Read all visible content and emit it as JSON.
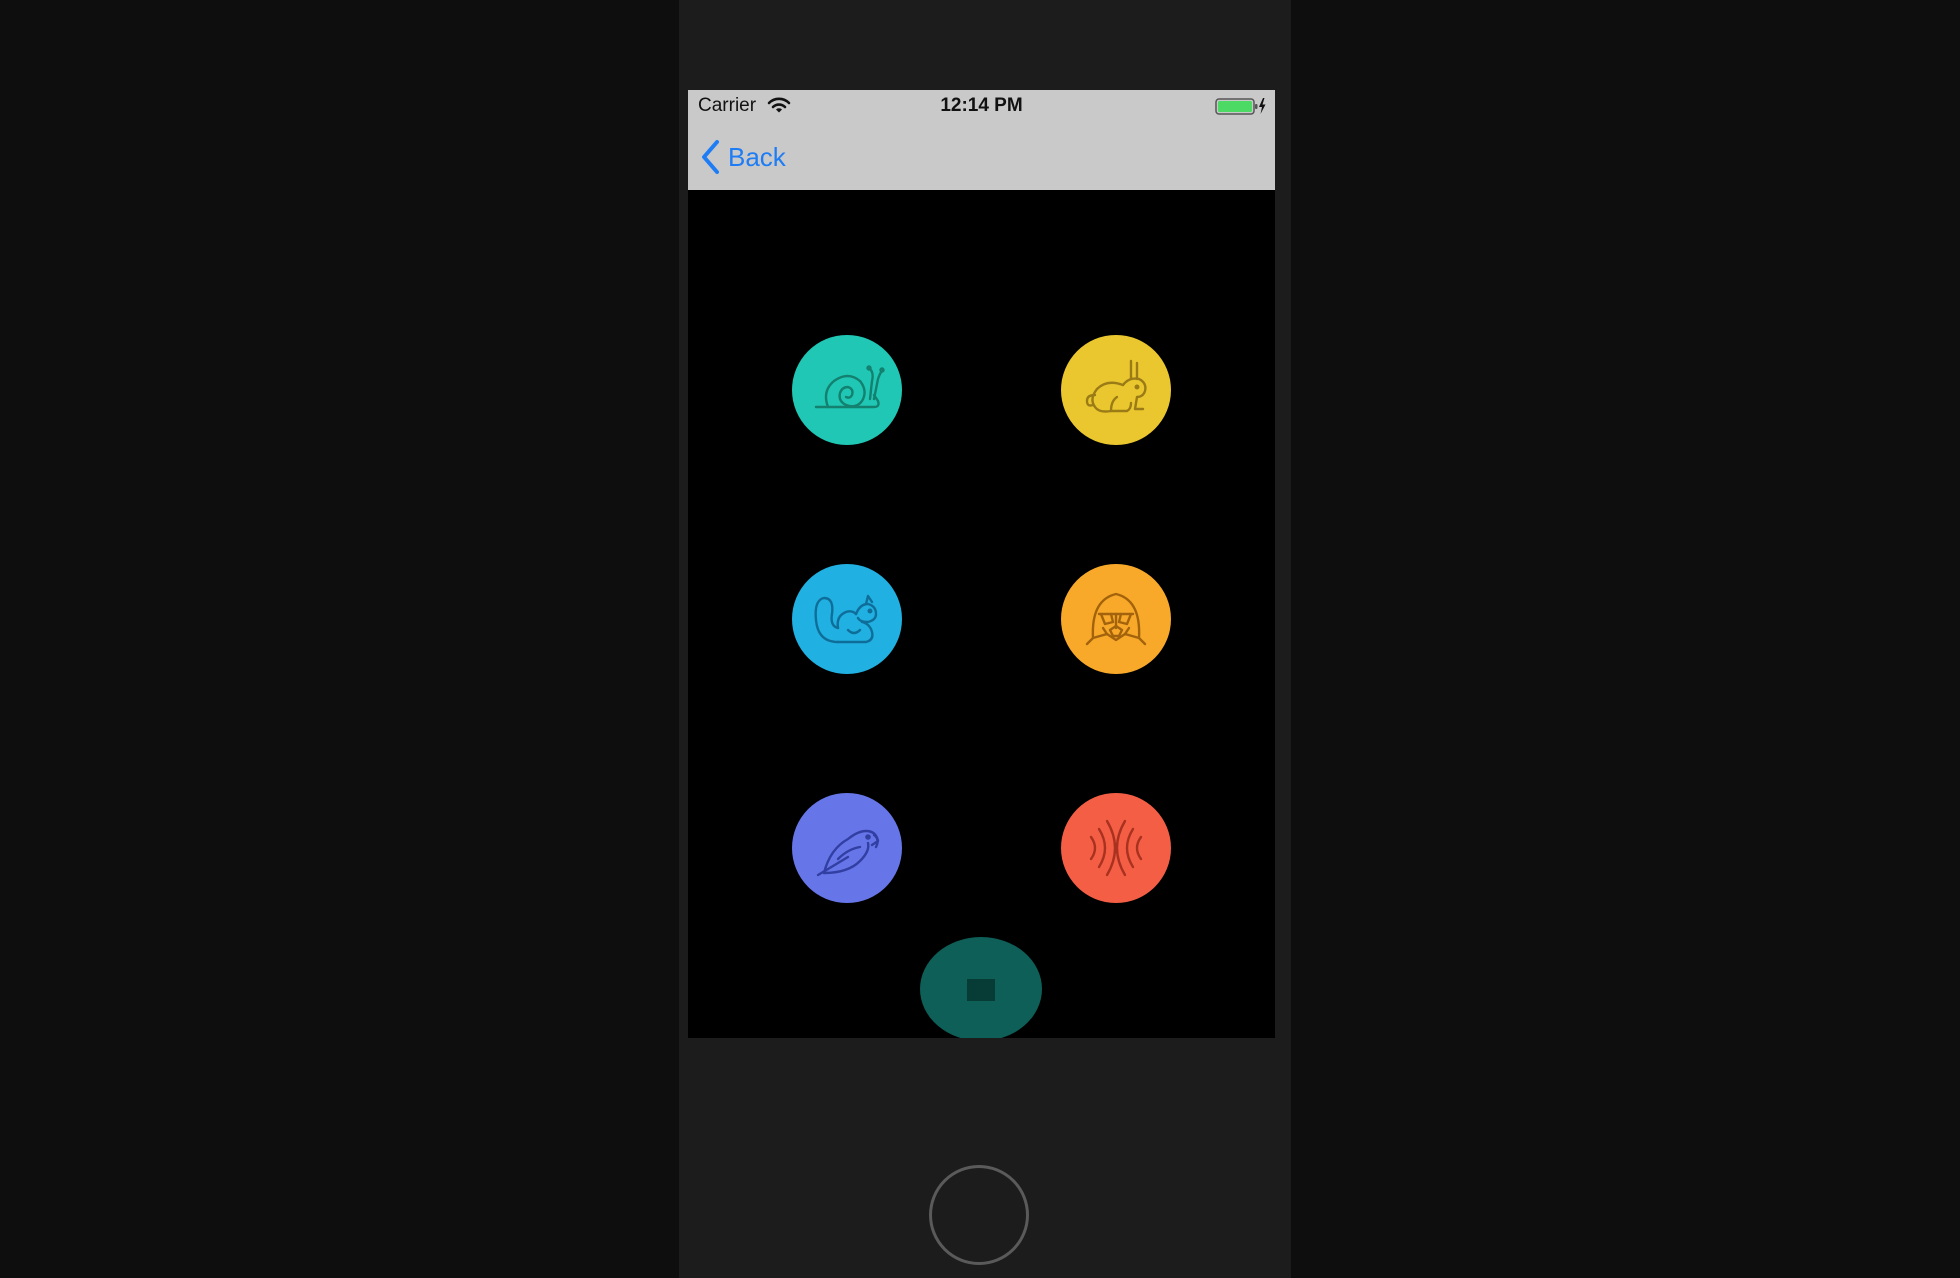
{
  "status_bar": {
    "carrier": "Carrier",
    "time": "12:14 PM",
    "battery_color": "#4cd964"
  },
  "nav": {
    "back_label": "Back",
    "tint_color": "#1e7df5"
  },
  "buttons": [
    {
      "name": "snail",
      "icon": "snail-icon",
      "color": "#1fc7b4"
    },
    {
      "name": "rabbit",
      "icon": "rabbit-icon",
      "color": "#eac72f"
    },
    {
      "name": "squirrel",
      "icon": "squirrel-icon",
      "color": "#20b0e1"
    },
    {
      "name": "darth-vader",
      "icon": "darth-vader-icon",
      "color": "#f9a92a"
    },
    {
      "name": "parrot",
      "icon": "parrot-icon",
      "color": "#6676e8"
    },
    {
      "name": "echo",
      "icon": "echo-waves-icon",
      "color": "#f45e45"
    }
  ],
  "stop_button": {
    "icon": "stop-icon",
    "color": "#0d5f58"
  }
}
